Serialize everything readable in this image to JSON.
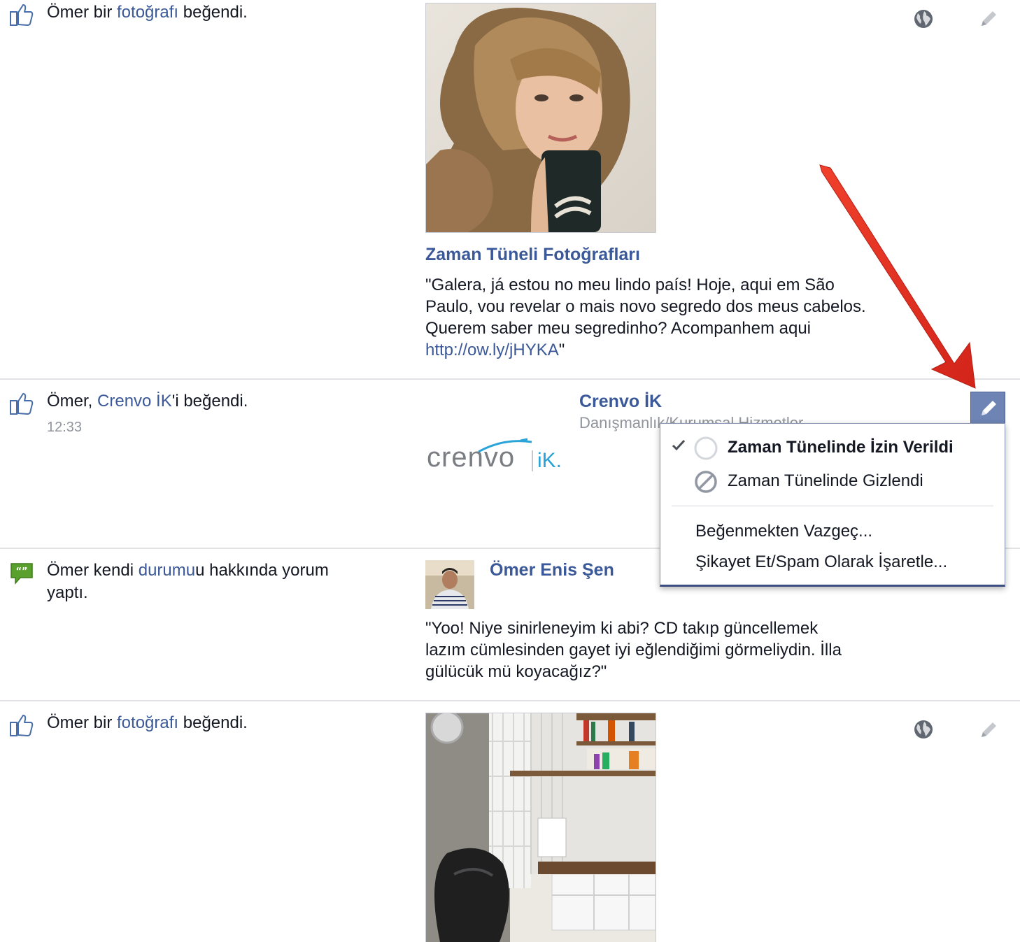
{
  "colors": {
    "link": "#3b5998",
    "text": "#141823",
    "muted": "#90949c",
    "separator": "#e1e2e6",
    "arrow": "#e8321f",
    "menu_border": "#3b4d81"
  },
  "story1": {
    "icon": "like-icon",
    "actor": "Ömer bir ",
    "link": "fotoğrafı",
    "rest": " beğendi.",
    "album_title": "Zaman Tüneli Fotoğrafları",
    "quote_line1": "\"Galera, já estou no meu lindo país! Hoje, aqui em São",
    "quote_line2": "Paulo, vou revelar o mais novo segredo dos meus cabelos.",
    "quote_line3": "Querem saber meu segredinho? Acompanhem aqui",
    "quote_url": "http://ow.ly/jHYKA",
    "quote_end": "\""
  },
  "story2": {
    "icon": "like-icon",
    "actor": "Ömer, ",
    "link": "Crenvo İK",
    "rest": "'i beğendi.",
    "time": "12:33",
    "page_name": "Crenvo İK",
    "page_category": "Danışmanlık/Kurumsal Hizmetler",
    "logo_text": "crenvo",
    "logo_suffix": "iK."
  },
  "story3": {
    "icon": "comment-icon",
    "actor": "Ömer kendi ",
    "link": "durumu",
    "rest": "u hakkında yorum",
    "rest2": "yaptı.",
    "author": "Ömer Enis Şen",
    "quote_line1": "\"Yoo! Niye sinirleneyim ki abi? CD takıp güncellemek",
    "quote_line2": "lazım cümlesinden gayet iyi eğlendiğimi görmeliydin. İlla",
    "quote_line3": "gülücük mü koyacağız?\""
  },
  "story4": {
    "icon": "like-icon",
    "actor": "Ömer bir ",
    "link": "fotoğrafı",
    "rest": " beğendi."
  },
  "menu": {
    "allowed": "Zaman Tünelinde İzin Verildi",
    "hidden": "Zaman Tünelinde Gizlendi",
    "unlike": "Beğenmekten Vazgeç...",
    "report": "Şikayet Et/Spam Olarak İşaretle..."
  }
}
